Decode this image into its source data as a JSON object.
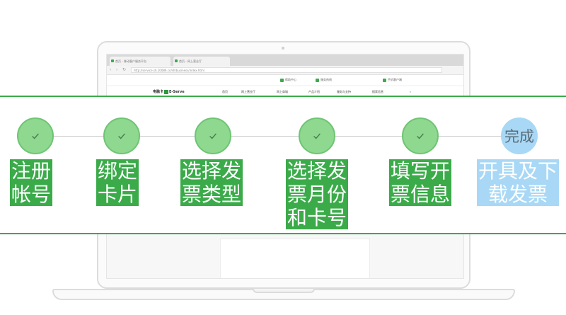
{
  "browser": {
    "tabs": [
      "首页 - 移动客户服务平台",
      "首页 - 网上营业厅"
    ],
    "address": "http://service.sh.10086.cn/sh/business/index.html"
  },
  "site": {
    "logo_left": "电融卡",
    "logo_right": "E-Serve",
    "top_links": [
      "帮助中心",
      "服务热线",
      "手机客户端"
    ],
    "nav_items": [
      "首页",
      "网上营业厅",
      "网上商城",
      "产品介绍",
      "服务与支持",
      "搜索信息"
    ]
  },
  "steps": [
    {
      "label": "注册\n帐号",
      "status": "done",
      "icon": "check-icon"
    },
    {
      "label": "绑定\n卡片",
      "status": "done",
      "icon": "check-icon"
    },
    {
      "label": "选择发\n票类型",
      "status": "done",
      "icon": "check-icon"
    },
    {
      "label": "选择发\n票月份\n和卡号",
      "status": "done",
      "icon": "check-icon"
    },
    {
      "label": "填写开\n票信息",
      "status": "done",
      "icon": "check-icon"
    },
    {
      "label": "开具及下\n载发票",
      "status": "current",
      "circle_text": "完成"
    }
  ],
  "colors": {
    "accent_green": "#3bab4a",
    "done_circle": "#8ed88f",
    "current_blue": "#a8d8f5"
  }
}
